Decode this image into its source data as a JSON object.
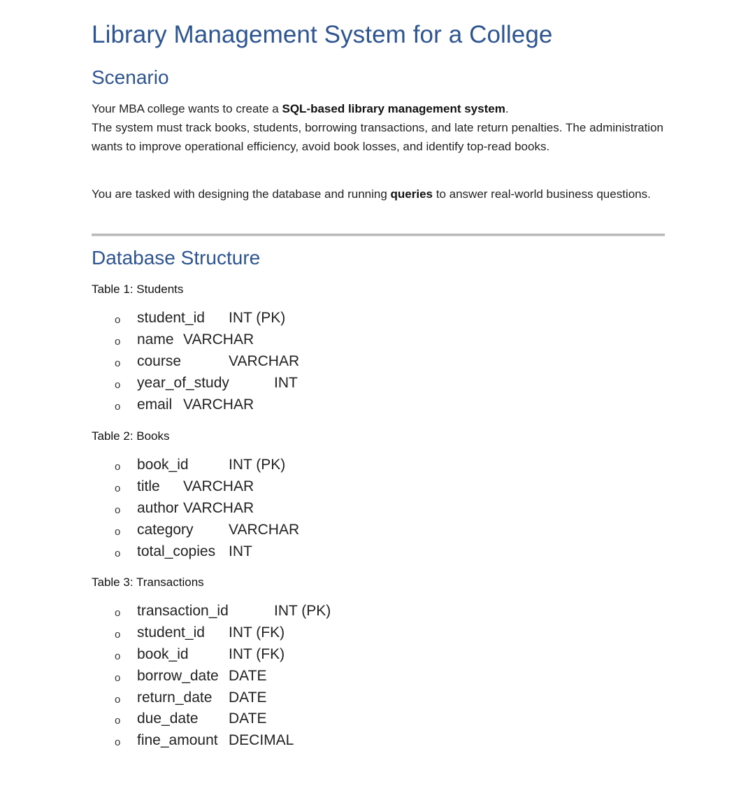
{
  "title": "Library Management System for a College",
  "scenario": {
    "heading": "Scenario",
    "p1_pre": "Your MBA college wants to create a ",
    "p1_bold": "SQL-based library management system",
    "p1_post": ".",
    "p2": "The system must track books, students, borrowing transactions, and late return penalties. The administration wants to improve operational efficiency, avoid book losses, and identify top-read books.",
    "p3_pre": "You are tasked with designing the database and running ",
    "p3_bold": "queries",
    "p3_post": " to answer real-world business questions."
  },
  "database": {
    "heading": "Database Structure",
    "tables": [
      {
        "label": "Table 1: Students",
        "fields": [
          {
            "bullet": "o",
            "name": "student_id",
            "type": "INT (PK)"
          },
          {
            "bullet": "o",
            "name": "name",
            "type": "VARCHAR"
          },
          {
            "bullet": "o",
            "name": "course",
            "type": "VARCHAR"
          },
          {
            "bullet": "o",
            "name": "year_of_study",
            "type": "INT"
          },
          {
            "bullet": "o",
            "name": "email",
            "type": "VARCHAR"
          }
        ]
      },
      {
        "label": "Table 2: Books",
        "fields": [
          {
            "bullet": "o",
            "name": "book_id",
            "type": "INT (PK)"
          },
          {
            "bullet": "o",
            "name": "title",
            "type": "VARCHAR"
          },
          {
            "bullet": "o",
            "name": "author",
            "type": "VARCHAR"
          },
          {
            "bullet": "o",
            "name": "category",
            "type": "VARCHAR"
          },
          {
            "bullet": "o",
            "name": "total_copies",
            "type": "INT"
          }
        ]
      },
      {
        "label": "Table 3: Transactions",
        "fields": [
          {
            "bullet": "o",
            "name": "transaction_id",
            "type": "INT (PK)"
          },
          {
            "bullet": "o",
            "name": "student_id",
            "type": "INT (FK)"
          },
          {
            "bullet": "o",
            "name": "book_id",
            "type": "INT (FK)"
          },
          {
            "bullet": "o",
            "name": "borrow_date",
            "type": "DATE"
          },
          {
            "bullet": "o",
            "name": "return_date",
            "type": "DATE"
          },
          {
            "bullet": "o",
            "name": "due_date",
            "type": "DATE"
          },
          {
            "bullet": "o",
            "name": "fine_amount",
            "type": "DECIMAL"
          }
        ]
      }
    ]
  },
  "colors": {
    "heading": "#2e5590",
    "body_text": "#222222",
    "rule": "#b9b9b9"
  }
}
